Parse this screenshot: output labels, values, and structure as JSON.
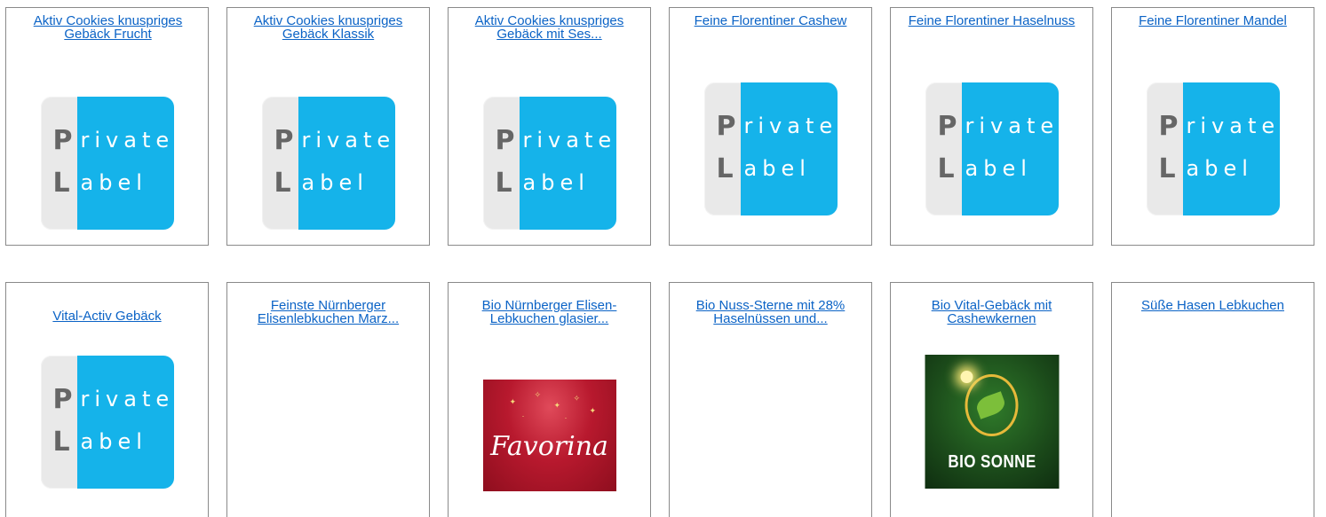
{
  "products": [
    {
      "title": "Aktiv Cookies knuspriges Gebäck Frucht",
      "logo": "private-label",
      "logo_letters": {
        "p": "P",
        "rivate": "rivate",
        "l": "L",
        "abel": "abel"
      }
    },
    {
      "title": "Aktiv Cookies knuspriges Gebäck Klassik",
      "logo": "private-label",
      "logo_letters": {
        "p": "P",
        "rivate": "rivate",
        "l": "L",
        "abel": "abel"
      }
    },
    {
      "title": "Aktiv Cookies knuspriges Gebäck mit Ses...",
      "logo": "private-label",
      "logo_letters": {
        "p": "P",
        "rivate": "rivate",
        "l": "L",
        "abel": "abel"
      }
    },
    {
      "title": "Feine Florentiner Cashew",
      "logo": "private-label",
      "logo_letters": {
        "p": "P",
        "rivate": "rivate",
        "l": "L",
        "abel": "abel"
      }
    },
    {
      "title": "Feine Florentiner Haselnuss",
      "logo": "private-label",
      "logo_letters": {
        "p": "P",
        "rivate": "rivate",
        "l": "L",
        "abel": "abel"
      }
    },
    {
      "title": "Feine Florentiner Mandel",
      "logo": "private-label",
      "logo_letters": {
        "p": "P",
        "rivate": "rivate",
        "l": "L",
        "abel": "abel"
      }
    },
    {
      "title": "Vital-Activ Gebäck",
      "logo": "private-label",
      "logo_letters": {
        "p": "P",
        "rivate": "rivate",
        "l": "L",
        "abel": "abel"
      }
    },
    {
      "title": "Feinste Nürnberger Elisenlebkuchen Marz...",
      "logo": "none"
    },
    {
      "title": "Bio Nürnberger Elisen-Lebkuchen glasier...",
      "logo": "favorina",
      "logo_text": "Favorina"
    },
    {
      "title": "Bio Nuss-Sterne mit 28% Haselnüssen und...",
      "logo": "none"
    },
    {
      "title": "Bio Vital-Gebäck mit Cashewkernen",
      "logo": "bio-sonne",
      "logo_text": "BIO SONNE"
    },
    {
      "title": "Süße Hasen Lebkuchen",
      "logo": "none"
    }
  ],
  "colors": {
    "link": "#0b63c6",
    "border": "#8a8a8a",
    "private_label_blue": "#15b3ea"
  }
}
